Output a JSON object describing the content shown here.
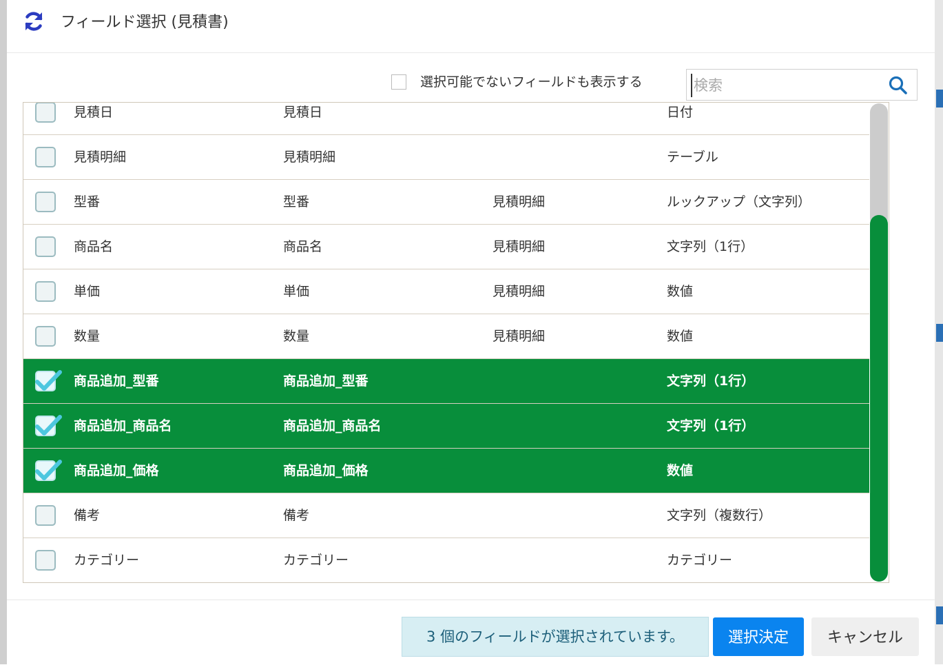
{
  "dialog": {
    "title": "フィールド選択 (見積書)",
    "icon": "refresh-icon"
  },
  "toolbar": {
    "show_unselectable_label": "選択可能でないフィールドも表示する",
    "show_unselectable_checked": false,
    "search_placeholder": "検索",
    "search_value": ""
  },
  "colors": {
    "selected_row": "#088e3b",
    "primary_button": "#0a84ef",
    "accent_icon": "#2b3cc0"
  },
  "rows": [
    {
      "name": "見積日",
      "code": "見積日",
      "table": "",
      "type": "日付",
      "checked": false
    },
    {
      "name": "見積明細",
      "code": "見積明細",
      "table": "",
      "type": "テーブル",
      "checked": false
    },
    {
      "name": "型番",
      "code": "型番",
      "table": "見積明細",
      "type": "ルックアップ（文字列）",
      "checked": false
    },
    {
      "name": "商品名",
      "code": "商品名",
      "table": "見積明細",
      "type": "文字列（1行）",
      "checked": false
    },
    {
      "name": "単価",
      "code": "単価",
      "table": "見積明細",
      "type": "数値",
      "checked": false
    },
    {
      "name": "数量",
      "code": "数量",
      "table": "見積明細",
      "type": "数値",
      "checked": false
    },
    {
      "name": "商品追加_型番",
      "code": "商品追加_型番",
      "table": "",
      "type": "文字列（1行）",
      "checked": true
    },
    {
      "name": "商品追加_商品名",
      "code": "商品追加_商品名",
      "table": "",
      "type": "文字列（1行）",
      "checked": true
    },
    {
      "name": "商品追加_価格",
      "code": "商品追加_価格",
      "table": "",
      "type": "数値",
      "checked": true
    },
    {
      "name": "備考",
      "code": "備考",
      "table": "",
      "type": "文字列（複数行）",
      "checked": false
    },
    {
      "name": "カテゴリー",
      "code": "カテゴリー",
      "table": "",
      "type": "カテゴリー",
      "checked": false
    }
  ],
  "footer": {
    "status": "3 個のフィールドが選択されています。",
    "confirm_label": "選択決定",
    "cancel_label": "キャンセル"
  }
}
